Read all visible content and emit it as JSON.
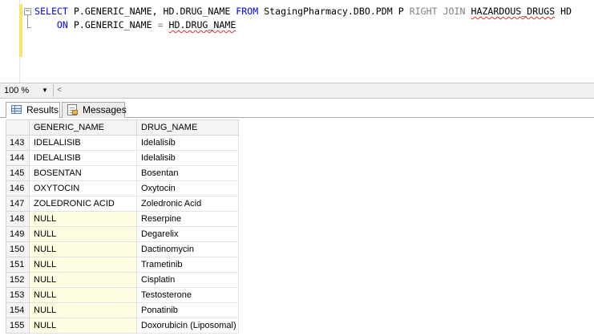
{
  "editor": {
    "line1": {
      "select": "SELECT",
      "cols": " P.GENERIC_NAME, HD.DRUG_NAME ",
      "from": "FROM",
      "source": " StagingPharmacy.DBO.PDM P ",
      "join": "RIGHT JOIN",
      "space": " ",
      "table": "HAZARDOUS_DRUGS",
      "alias": " HD"
    },
    "line2": {
      "indent": "    ",
      "on": "ON",
      "left": " P.GENERIC_NAME ",
      "eq": "=",
      "space": " ",
      "right": "HD.DRUG_NAME"
    },
    "collapse_glyph": "−"
  },
  "zoom": {
    "value": "100 %",
    "dropdown_glyph": "▼",
    "scroll_left_glyph": "<"
  },
  "tabs": [
    {
      "label": "Results",
      "icon": "grid-icon",
      "active": true
    },
    {
      "label": "Messages",
      "icon": "messages-icon",
      "active": false
    }
  ],
  "results": {
    "columns": [
      "GENERIC_NAME",
      "DRUG_NAME"
    ],
    "rows": [
      {
        "n": "143",
        "generic": "IDELALISIB",
        "drug": "Idelalisib"
      },
      {
        "n": "144",
        "generic": "IDELALISIB",
        "drug": "Idelalisib"
      },
      {
        "n": "145",
        "generic": "BOSENTAN",
        "drug": "Bosentan"
      },
      {
        "n": "146",
        "generic": "OXYTOCIN",
        "drug": "Oxytocin"
      },
      {
        "n": "147",
        "generic": "ZOLEDRONIC ACID",
        "drug": "Zoledronic Acid"
      },
      {
        "n": "148",
        "generic": "NULL",
        "drug": "Reserpine"
      },
      {
        "n": "149",
        "generic": "NULL",
        "drug": "Degarelix"
      },
      {
        "n": "150",
        "generic": "NULL",
        "drug": "Dactinomycin"
      },
      {
        "n": "151",
        "generic": "NULL",
        "drug": "Trametinib"
      },
      {
        "n": "152",
        "generic": "NULL",
        "drug": "Cisplatin"
      },
      {
        "n": "153",
        "generic": "NULL",
        "drug": "Testosterone"
      },
      {
        "n": "154",
        "generic": "NULL",
        "drug": "Ponatinib"
      },
      {
        "n": "155",
        "generic": "NULL",
        "drug": "Doxorubicin (Liposomal)"
      }
    ]
  },
  "colors": {
    "keyword": "#0000ff",
    "join_keyword": "#808080",
    "null_cell": "#fffde1",
    "change_bar": "#f7e36e"
  }
}
